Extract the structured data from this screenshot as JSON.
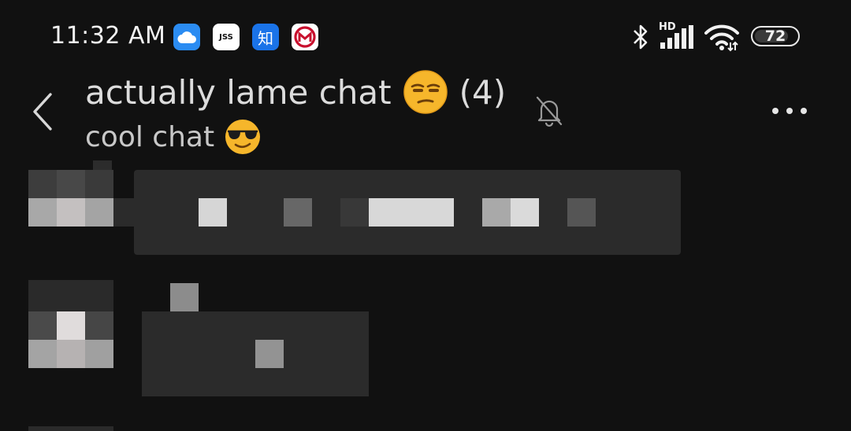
{
  "status_bar": {
    "time": "11:32 AM",
    "app_icons": [
      "cloud-icon",
      "jss-icon",
      "zhihu-icon",
      "bank-icon"
    ],
    "jss_text": "JSS",
    "zhihu_text": "知",
    "network": "HD",
    "battery_percent": "72"
  },
  "header": {
    "title": "actually lame chat",
    "title_emoji": "unamused-face-emoji",
    "member_count": "(4)",
    "subtitle": "cool chat",
    "subtitle_emoji": "sunglasses-face-emoji",
    "muted": true
  },
  "colors": {
    "background": "#111111",
    "bubble": "#2b2b2b",
    "emoji_yellow": "#f6b62b"
  }
}
